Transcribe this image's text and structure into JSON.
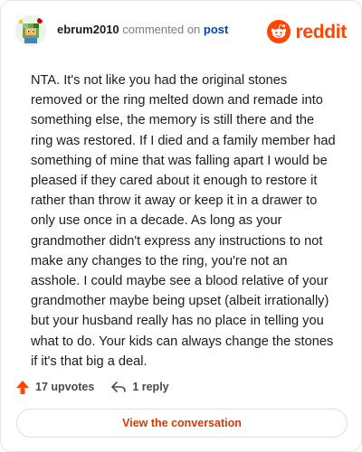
{
  "header": {
    "username": "ebrum2010",
    "action_text": "commented on",
    "post_link": "post",
    "brand_text": "reddit"
  },
  "comment": {
    "body": "NTA. It's not like you had the original stones removed or the ring melted down and remade into something else, the memory is still there and the ring was restored. If I died and a family member had something of mine that was falling apart I would be pleased if they cared about it enough to restore it rather than throw it away or keep it in a drawer to only use once in a decade. As long as your grandmother didn't express any instructions to not make any changes to the ring, you're not an asshole. I could maybe see a blood relative of your grandmother maybe being upset (albeit irrationally) but your husband really has no place in telling you what to do. Your kids can always change the stones if it's that big a deal."
  },
  "footer": {
    "upvotes_label": "17 upvotes",
    "reply_label": "1 reply"
  },
  "cta": {
    "label": "View the conversation"
  },
  "colors": {
    "brand": "#ff4500",
    "link": "#0045ac",
    "cta_text": "#d93900"
  }
}
